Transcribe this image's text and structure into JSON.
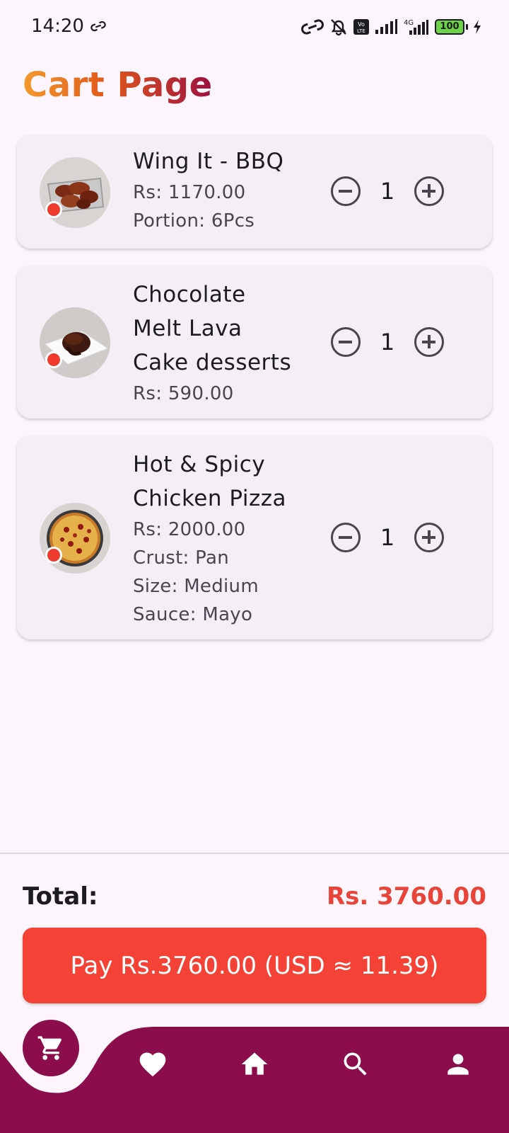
{
  "status_bar": {
    "time": "14:20",
    "battery": "100",
    "network": "4G"
  },
  "page": {
    "title": "Cart Page"
  },
  "cart": {
    "items": [
      {
        "name": "Wing It - BBQ",
        "price": "Rs: 1170.00",
        "details": [
          "Portion: 6Pcs"
        ],
        "quantity": "1",
        "image": "bbq-wings-image"
      },
      {
        "name": "Chocolate Melt Lava Cake desserts",
        "name_lines": [
          "Chocolate",
          "Melt Lava",
          "Cake desserts"
        ],
        "price": "Rs: 590.00",
        "details": [],
        "quantity": "1",
        "image": "lava-cake-image"
      },
      {
        "name": "Hot & Spicy Chicken Pizza",
        "name_lines": [
          "Hot & Spicy",
          "Chicken Pizza"
        ],
        "price": "Rs: 2000.00",
        "details": [
          "Crust: Pan",
          "Size: Medium",
          "Sauce: Mayo"
        ],
        "quantity": "1",
        "image": "pizza-image"
      }
    ]
  },
  "summary": {
    "total_label": "Total:",
    "total_value": "Rs. 3760.00",
    "pay_button": "Pay Rs.3760.00 (USD ≈ 11.39)"
  },
  "colors": {
    "accent": "#f44336",
    "nav_bar": "#8b0d4b",
    "title_gradient": [
      "#f39a2d",
      "#e0561b",
      "#9c1040"
    ]
  },
  "bottom_nav": {
    "items": [
      "cart-icon",
      "heart-icon",
      "home-icon",
      "search-icon",
      "person-icon"
    ],
    "active": "cart-icon"
  }
}
